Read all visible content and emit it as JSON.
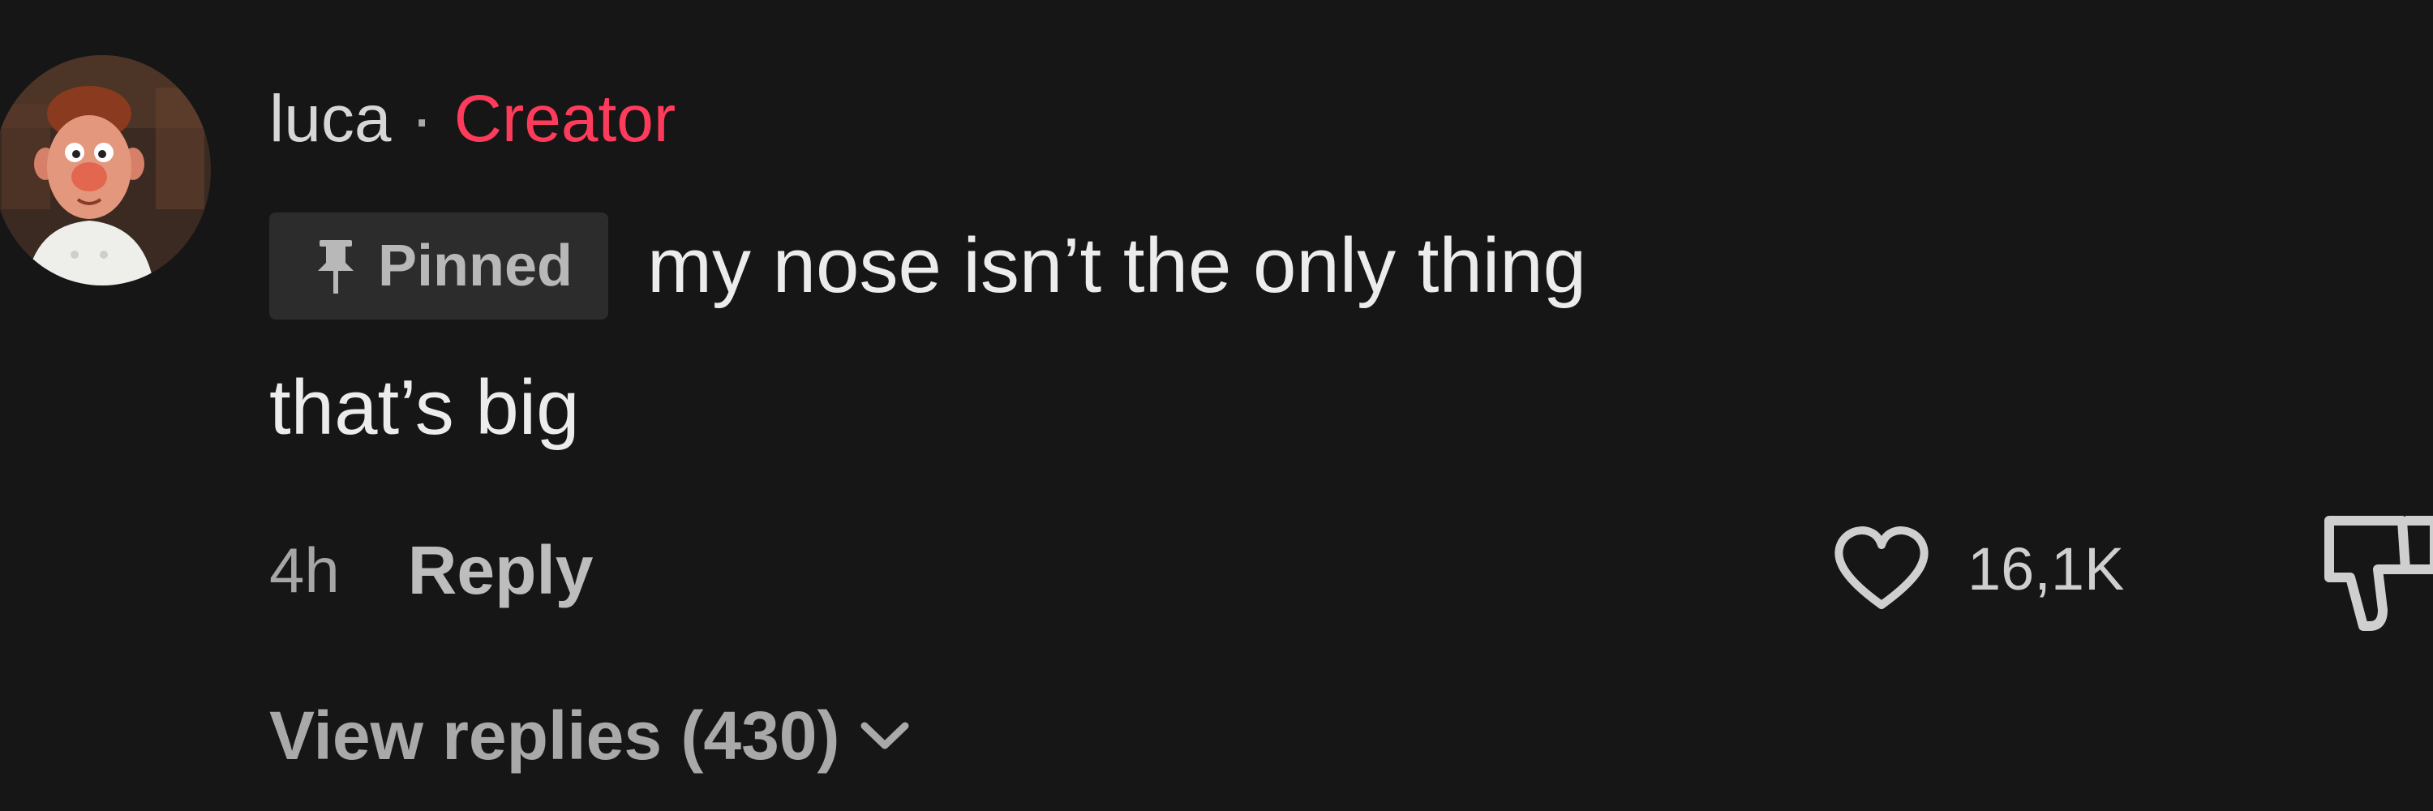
{
  "comment": {
    "avatar_icon": "chef-character-avatar",
    "username": "luca",
    "separator": "·",
    "role_badge": "Creator",
    "pinned_label": "Pinned",
    "text_line1": "my nose isn’t the only thing",
    "text_line2": "that’s big",
    "timestamp": "4h",
    "reply_label": "Reply",
    "like_count": "16,1K",
    "view_replies_label": "View replies (430)"
  },
  "colors": {
    "background": "#161616",
    "creator_accent": "#ff3b5c",
    "pinned_badge_bg": "#2c2c2c"
  },
  "icons": [
    "pin-icon",
    "heart-icon",
    "dislike-icon",
    "chevron-down-icon"
  ]
}
